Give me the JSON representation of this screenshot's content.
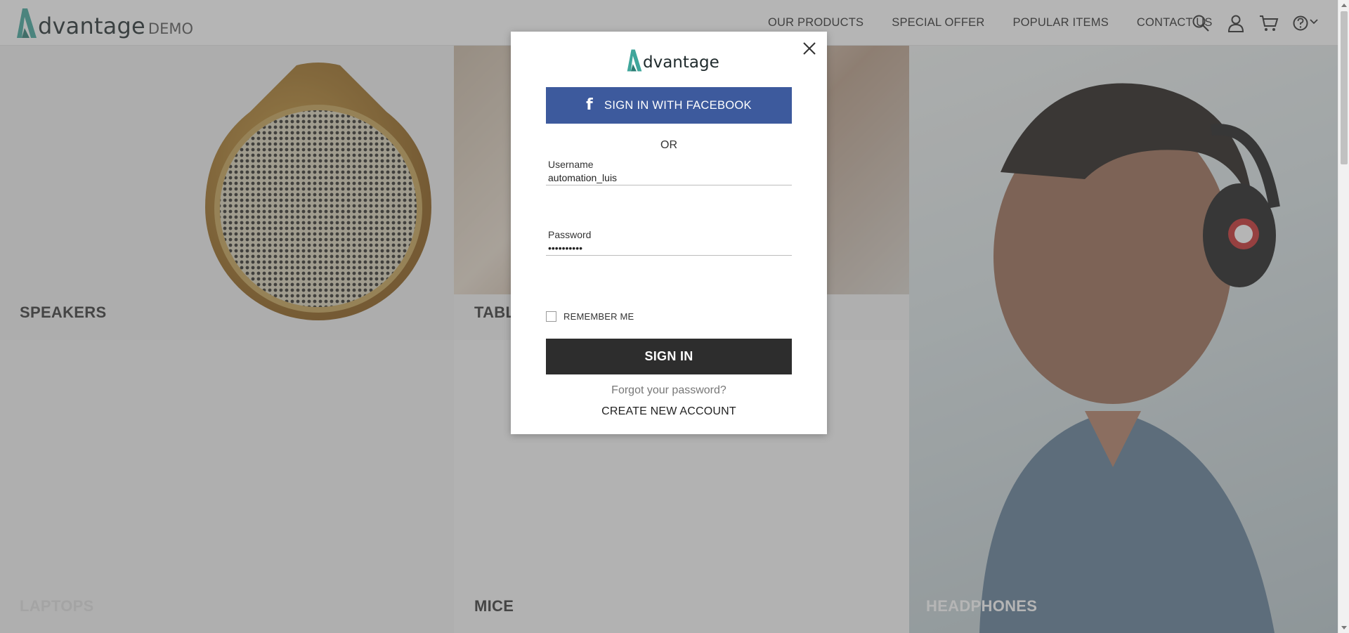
{
  "header": {
    "logo_text": "dvantage",
    "logo_suffix": "DEMO",
    "nav": [
      {
        "label": "OUR PRODUCTS"
      },
      {
        "label": "SPECIAL OFFER"
      },
      {
        "label": "POPULAR ITEMS"
      },
      {
        "label": "CONTACT US"
      }
    ],
    "icons": [
      "search-icon",
      "user-icon",
      "cart-icon",
      "help-icon",
      "chevron-down-icon"
    ]
  },
  "categories": {
    "speakers": "SPEAKERS",
    "tablets": "TABL",
    "headphones": "HEADPHONES",
    "laptops": "LAPTOPS",
    "mice": "MICE"
  },
  "modal": {
    "logo_text": "dvantage",
    "facebook_label": "SIGN IN WITH FACEBOOK",
    "or_text": "OR",
    "username_label": "Username",
    "username_value": "automation_luis",
    "password_label": "Password",
    "password_value": "••••••••••",
    "remember_label": "REMEMBER ME",
    "signin_label": "SIGN IN",
    "forgot_label": "Forgot your password?",
    "create_label": "CREATE NEW ACCOUNT"
  },
  "colors": {
    "brand_teal": "#3fa69b",
    "facebook_blue": "#3d5a9d",
    "signin_dark": "#2d2d2d"
  }
}
